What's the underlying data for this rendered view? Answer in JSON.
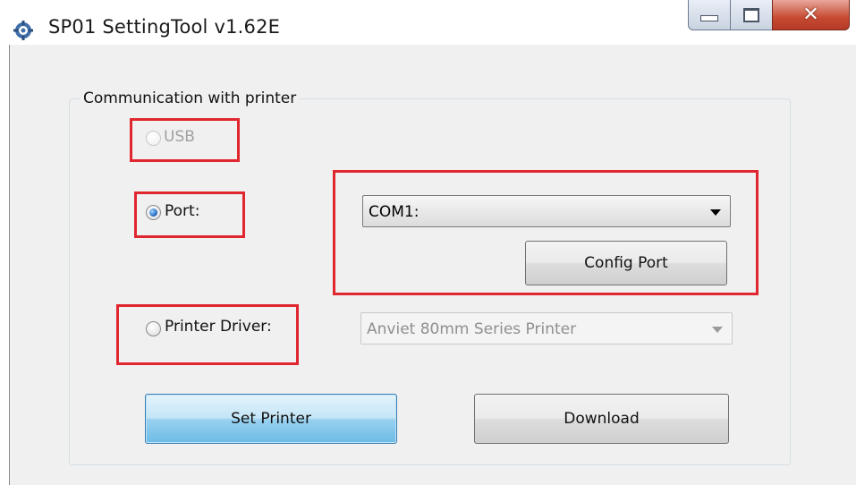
{
  "window": {
    "title": "SP01 SettingTool v1.62E",
    "icon": "gear-icon",
    "controls": {
      "minimize": "minimize-icon",
      "maximize": "maximize-icon",
      "close": "✕"
    }
  },
  "group": {
    "legend": "Communication with printer"
  },
  "options": {
    "usb": {
      "label": "USB",
      "selected": false,
      "enabled": false
    },
    "port": {
      "label": "Port:",
      "selected": true,
      "enabled": true
    },
    "printer_driver": {
      "label": "Printer Driver:",
      "selected": false,
      "enabled": true
    }
  },
  "port_select": {
    "value": "COM1:"
  },
  "config_port_button": {
    "label": "Config Port"
  },
  "driver_select": {
    "value": "Anviet 80mm Series Printer",
    "enabled": false
  },
  "actions": {
    "set_printer": "Set Printer",
    "download": "Download"
  },
  "colors": {
    "highlight_box": "#e0262e",
    "primary_button": "#98d1ef",
    "close_button": "#c74a33"
  }
}
